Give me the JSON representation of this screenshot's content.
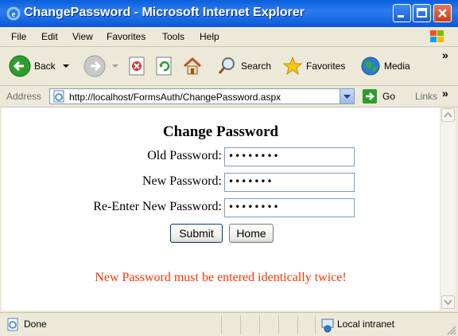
{
  "window": {
    "title": "ChangePassword - Microsoft Internet Explorer",
    "buttons": [
      "minimize-icon",
      "maximize-icon",
      "close-icon"
    ]
  },
  "menubar": {
    "items": [
      {
        "label": "File"
      },
      {
        "label": "Edit"
      },
      {
        "label": "View"
      },
      {
        "label": "Favorites"
      },
      {
        "label": "Tools"
      },
      {
        "label": "Help"
      }
    ]
  },
  "toolbar": {
    "back_label": "Back",
    "search_label": "Search",
    "favorites_label": "Favorites",
    "media_label": "Media",
    "overflow": "»"
  },
  "addressbar": {
    "label": "Address",
    "url": "http://localhost/FormsAuth/ChangePassword.aspx",
    "go_label": "Go",
    "links_label": "Links",
    "overflow": "»"
  },
  "form": {
    "title": "Change Password",
    "old_label": "Old Password:",
    "old_value": "••••••••",
    "new_label": "New Password:",
    "new_value": "•••••••",
    "reenter_label": "Re-Enter New Password:",
    "reenter_value": "••••••••",
    "submit_label": "Submit",
    "home_label": "Home",
    "error_message": "New Password must be entered identically twice!"
  },
  "statusbar": {
    "status": "Done",
    "zone": "Local intranet"
  },
  "colors": {
    "titlebar": "#0a5fdc",
    "error": "#ff3300",
    "chrome": "#ece9d8"
  }
}
